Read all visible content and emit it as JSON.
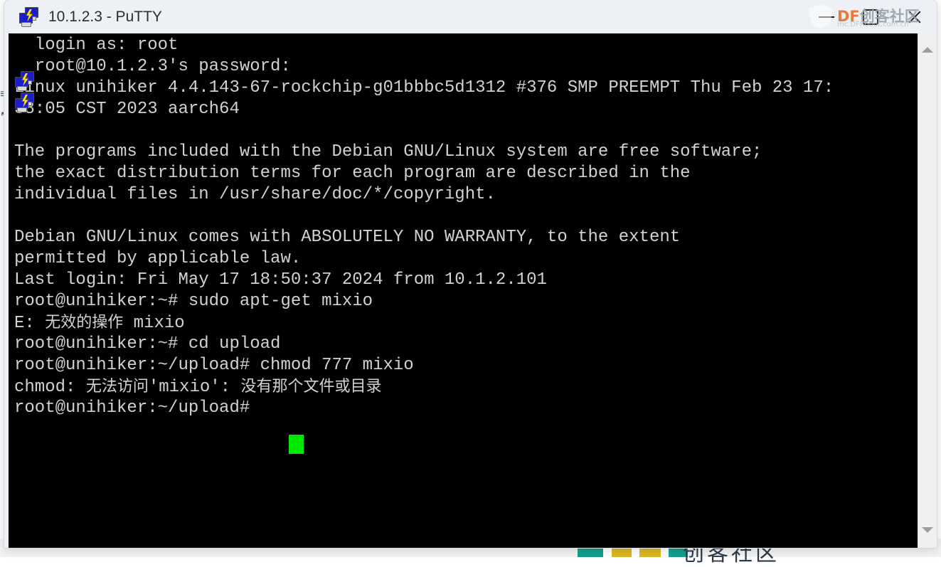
{
  "window": {
    "title": "10.1.2.3 - PuTTY",
    "icon": "putty-icon",
    "controls": {
      "minimize_label": "Minimize",
      "maximize_label": "Maximize",
      "close_label": "Close"
    }
  },
  "watermark": {
    "brand": "DF",
    "brand_cn": "创客社区",
    "subtitle": "mc.DFRobot.com.cn",
    "brand_color": "#e8722a"
  },
  "terminal": {
    "background_color": "#000000",
    "text_color": "#d2d2d2",
    "cursor_color": "#00e800",
    "lines": [
      "  login as: root",
      "  root@10.1.2.3's password:",
      "Linux unihiker 4.4.143-67-rockchip-g01bbbc5d1312 #376 SMP PREEMPT Thu Feb 23 17:",
      "38:05 CST 2023 aarch64",
      "",
      "The programs included with the Debian GNU/Linux system are free software;",
      "the exact distribution terms for each program are described in the",
      "individual files in /usr/share/doc/*/copyright.",
      "",
      "Debian GNU/Linux comes with ABSOLUTELY NO WARRANTY, to the extent",
      "permitted by applicable law.",
      "Last login: Fri May 17 18:50:37 2024 from 10.1.2.101",
      "root@unihiker:~# sudo apt-get mixio",
      "E: 无效的操作 mixio",
      "root@unihiker:~# cd upload",
      "root@unihiker:~/upload# chmod 777 mixio",
      "chmod: 无法访问'mixio': 没有那个文件或目录",
      "root@unihiker:~/upload# "
    ],
    "scrollbar": {
      "up_arrow": "scroll-up-arrow",
      "down_arrow": "scroll-down-arrow"
    }
  },
  "background": {
    "cjk_fragment": "创客社区"
  }
}
